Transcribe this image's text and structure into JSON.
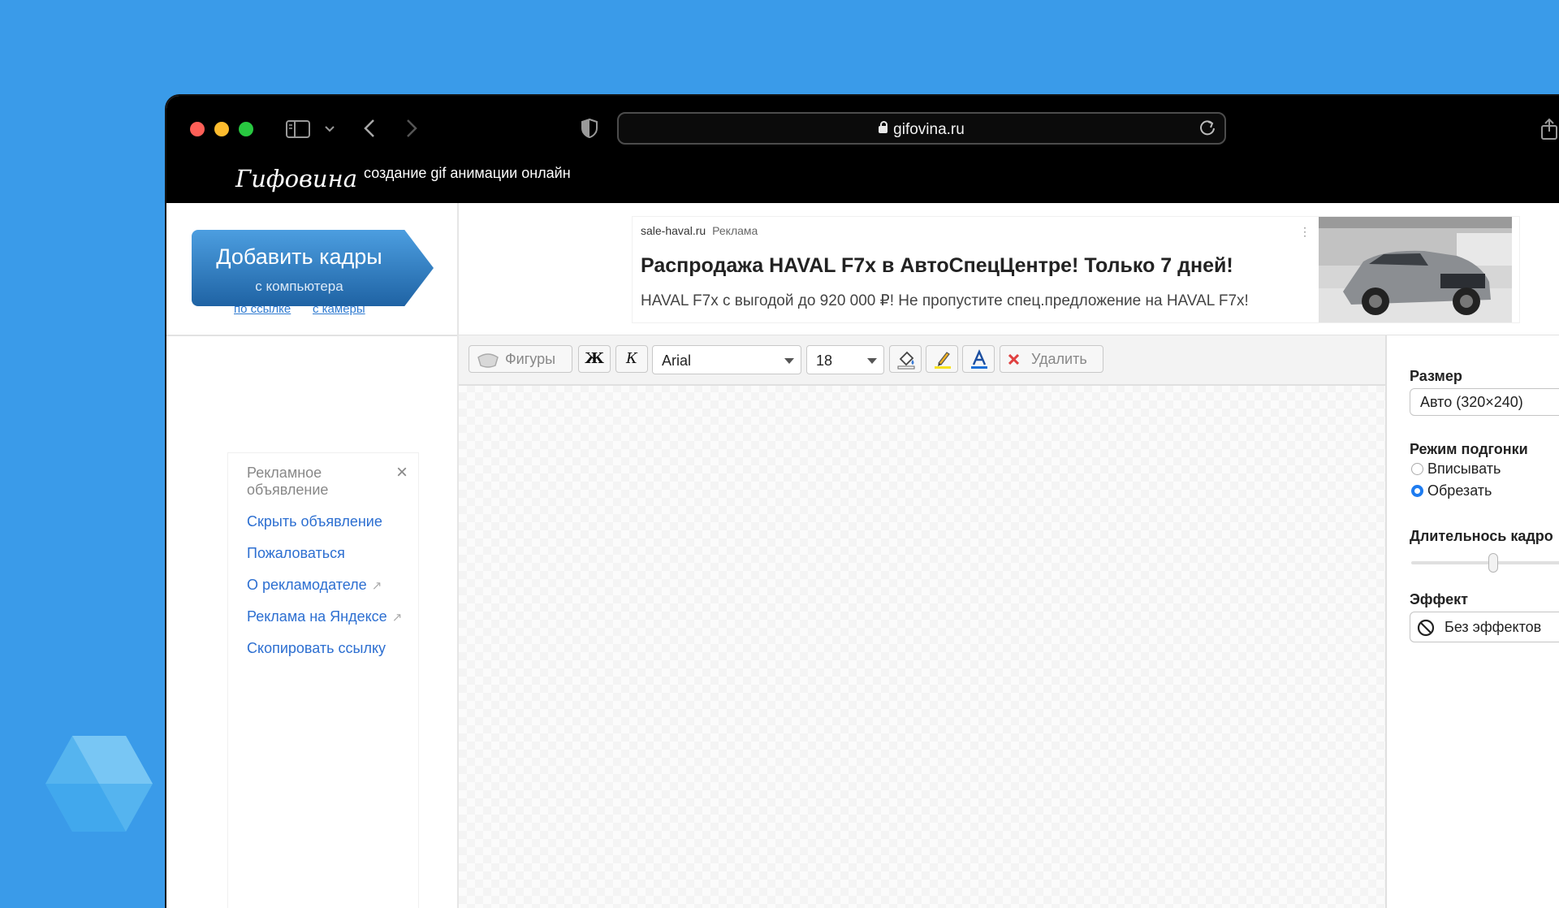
{
  "browser": {
    "url": "gifovina.ru"
  },
  "site": {
    "brand": "Гифовина",
    "tagline": "создание gif анимации онлайн"
  },
  "upload": {
    "main_label": "Добавить кадры",
    "sub_label": "с компьютера",
    "link_url": "по ссылке",
    "link_camera": "с камеры"
  },
  "ad": {
    "source": "sale-haval.ru",
    "source_label": "Реклама",
    "title": "Распродажа HAVAL F7x в АвтоСпецЦентре! Только 7 дней!",
    "description": "HAVAL F7x с выгодой до 920 000 ₽! Не пропустите спец.предложение на HAVAL F7x!"
  },
  "ad_menu": {
    "title": "Рекламное объявление",
    "items": [
      {
        "label": "Скрыть объявление"
      },
      {
        "label": "Пожаловаться"
      },
      {
        "label": "О рекламодателе"
      },
      {
        "label": "Реклама на Яндексе"
      },
      {
        "label": "Скопировать ссылку"
      }
    ]
  },
  "toolbar": {
    "shapes_label": "Фигуры",
    "bold_label": "Ж",
    "italic_label": "К",
    "font_value": "Arial",
    "size_value": "18",
    "delete_label": "Удалить"
  },
  "settings": {
    "size_label": "Размер",
    "size_value": "Авто (320×240)",
    "fit_label": "Режим подгонки",
    "fit_options": [
      {
        "label": "Вписывать",
        "selected": false
      },
      {
        "label": "Обрезать",
        "selected": true
      }
    ],
    "duration_label": "Длительнось кадро",
    "effect_label": "Эффект",
    "effect_value": "Без эффектов"
  },
  "colors": {
    "desktop": "#3a9be9",
    "accent": "#1e7cf0",
    "link": "#2d6fd1"
  }
}
